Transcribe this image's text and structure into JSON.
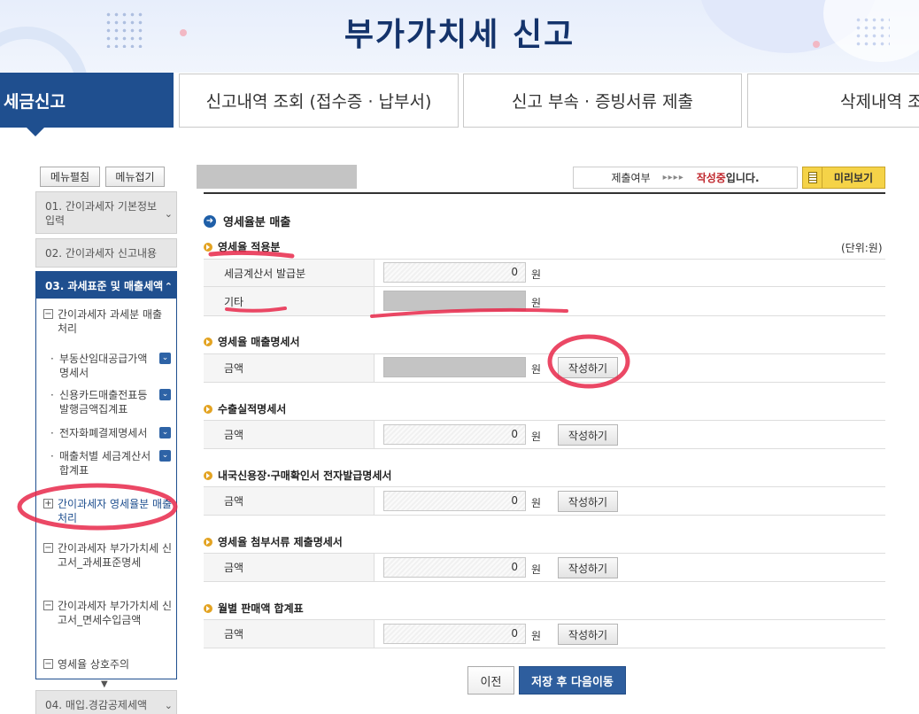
{
  "page_title": "부가가치세 신고",
  "tabs": [
    {
      "label": "세금신고",
      "active": true
    },
    {
      "label": "신고내역 조회 (접수증 · 납부서)"
    },
    {
      "label": "신고 부속 · 증빙서류 제출"
    },
    {
      "label": "삭제내역 조회"
    }
  ],
  "sidebar": {
    "expand_label": "메뉴펼침",
    "collapse_label": "메뉴접기",
    "steps": [
      {
        "label": "01. 간이과세자 기본정보 입력"
      },
      {
        "label": "02. 간이과세자 신고내용"
      },
      {
        "label": "03. 과세표준 및 매출세액"
      },
      {
        "label": "04. 매입.경감공제세액"
      }
    ],
    "sub_items": [
      {
        "label": "간이과세자 과세분 매출 처리",
        "box": "−"
      },
      {
        "label": "간이과세자 영세율분 매출 처리",
        "box": "+"
      },
      {
        "label": "간이과세자 부가가치세 신고서_과세표준명세",
        "box": "−"
      },
      {
        "label": "간이과세자 부가가치세 신고서_면세수입금액",
        "box": "−"
      },
      {
        "label": "영세율 상호주의",
        "box": "−"
      }
    ],
    "sub_sub_items": [
      {
        "label": "부동산임대공급가액명세서"
      },
      {
        "label": "신용카드매출전표등발행금액집계표"
      },
      {
        "label": "전자화폐결제명세서"
      },
      {
        "label": "매출처별 세금계산서합계표"
      }
    ]
  },
  "status": {
    "label": "제출여부",
    "arrows": "▸▸▸▸",
    "state": "작성중",
    "suffix": "입니다."
  },
  "preview_label": "미리보기",
  "section_title": "영세율분 매출",
  "unit_label": "(단위:원)",
  "currency_unit": "원",
  "write_label": "작성하기",
  "groups": {
    "applied": {
      "title": "영세율 적용분",
      "rows": [
        {
          "label": "세금계산서 발급분",
          "value": "0"
        },
        {
          "label": "기타",
          "value": ""
        }
      ]
    },
    "sales_statement": {
      "title": "영세율 매출명세서",
      "row_label": "금액",
      "value": ""
    },
    "export": {
      "title": "수출실적명세서",
      "row_label": "금액",
      "value": "0"
    },
    "local_lc": {
      "title": "내국신용장·구매확인서 전자발급명세서",
      "row_label": "금액",
      "value": "0"
    },
    "attached_docs": {
      "title": "영세율 첨부서류 제출명세서",
      "row_label": "금액",
      "value": "0"
    },
    "monthly": {
      "title": "월별 판매액 합계표",
      "row_label": "금액",
      "value": "0"
    }
  },
  "buttons": {
    "prev": "이전",
    "save_next": "저장 후 다음이동"
  },
  "colors": {
    "primary": "#1f4f8f",
    "accent_red": "#c0272d",
    "preview_yellow": "#f5d348",
    "annotation": "#e8284a"
  }
}
